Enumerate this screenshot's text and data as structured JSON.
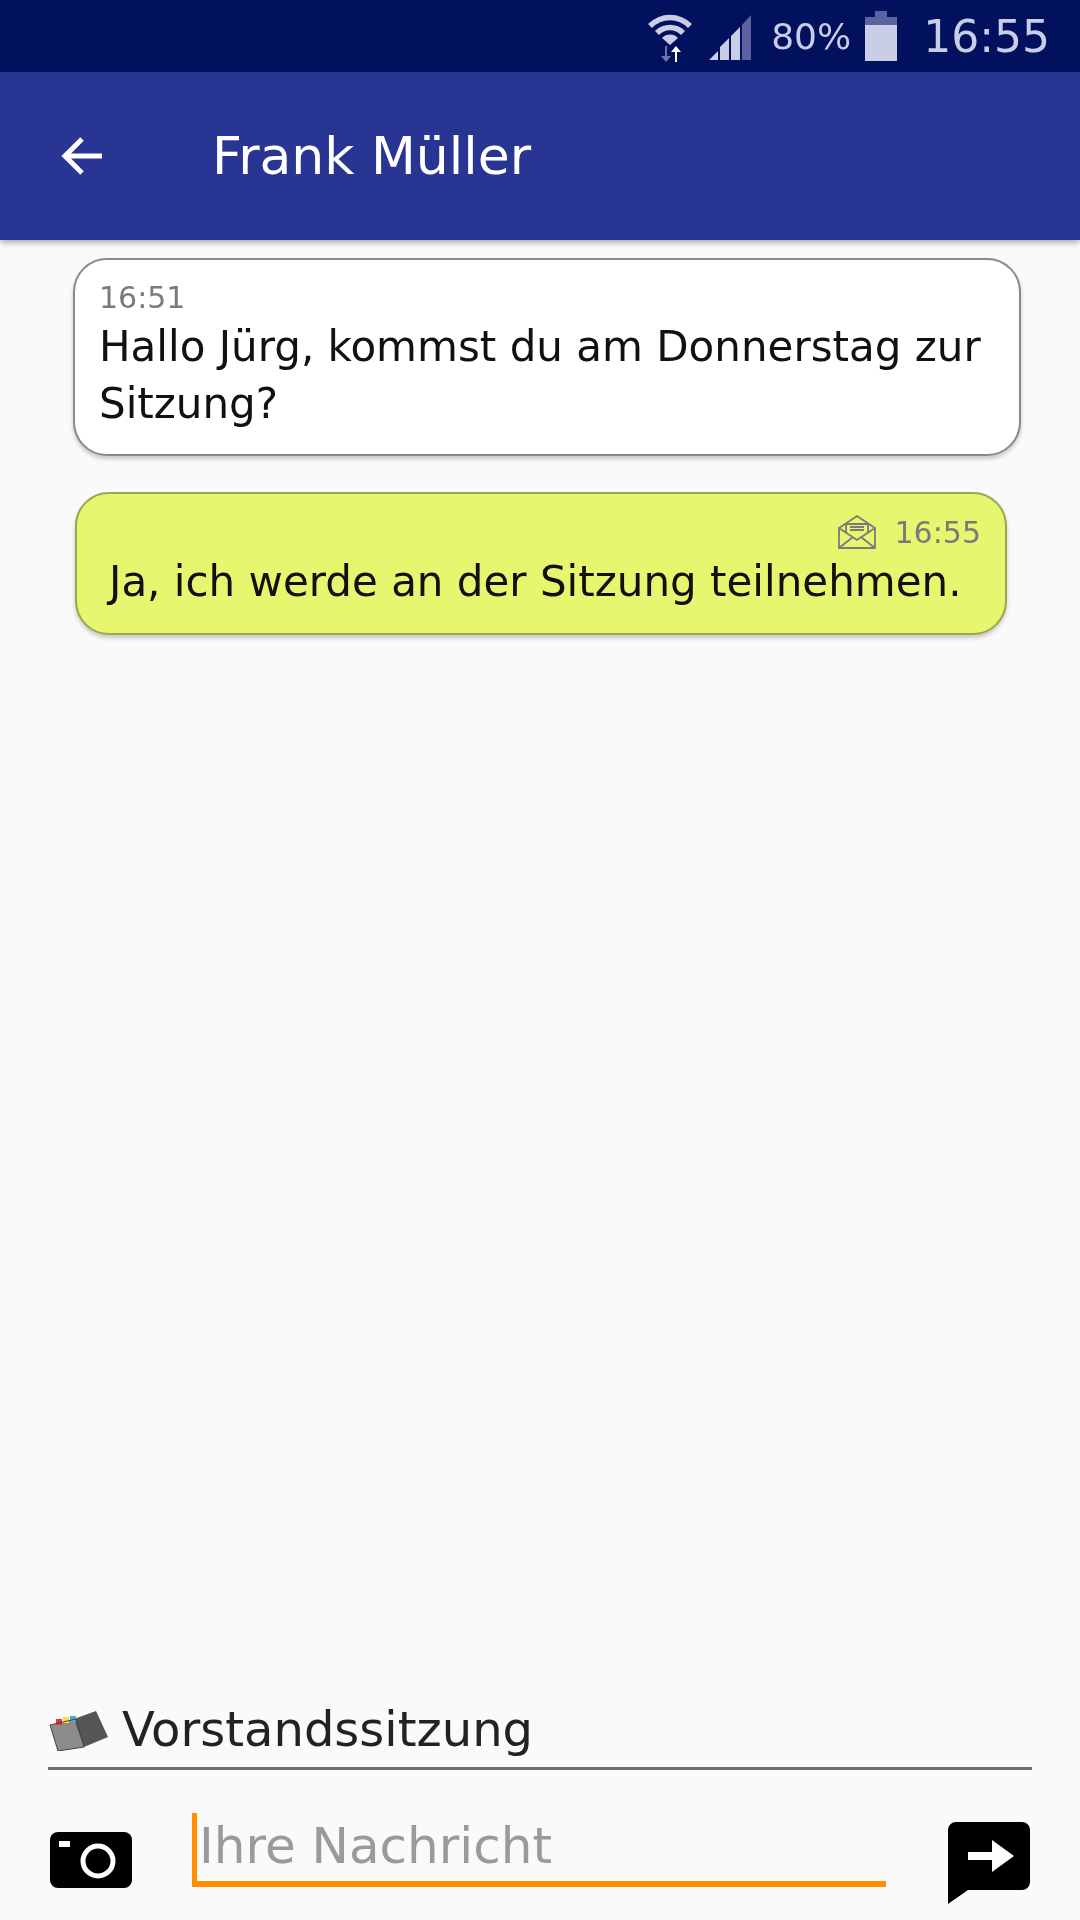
{
  "status_bar": {
    "battery": "80%",
    "time": "16:55"
  },
  "app_bar": {
    "title": "Frank Müller"
  },
  "messages": [
    {
      "kind": "incoming",
      "time": "16:51",
      "text": "Hallo Jürg, kommst du am Donnerstag zur Sitzung?"
    },
    {
      "kind": "outgoing",
      "time": "16:55",
      "text": "Ja, ich werde an der Sitzung teilnehmen."
    }
  ],
  "subject": {
    "text": "Vorstandssitzung"
  },
  "composer": {
    "placeholder": "Ihre Nachricht"
  }
}
